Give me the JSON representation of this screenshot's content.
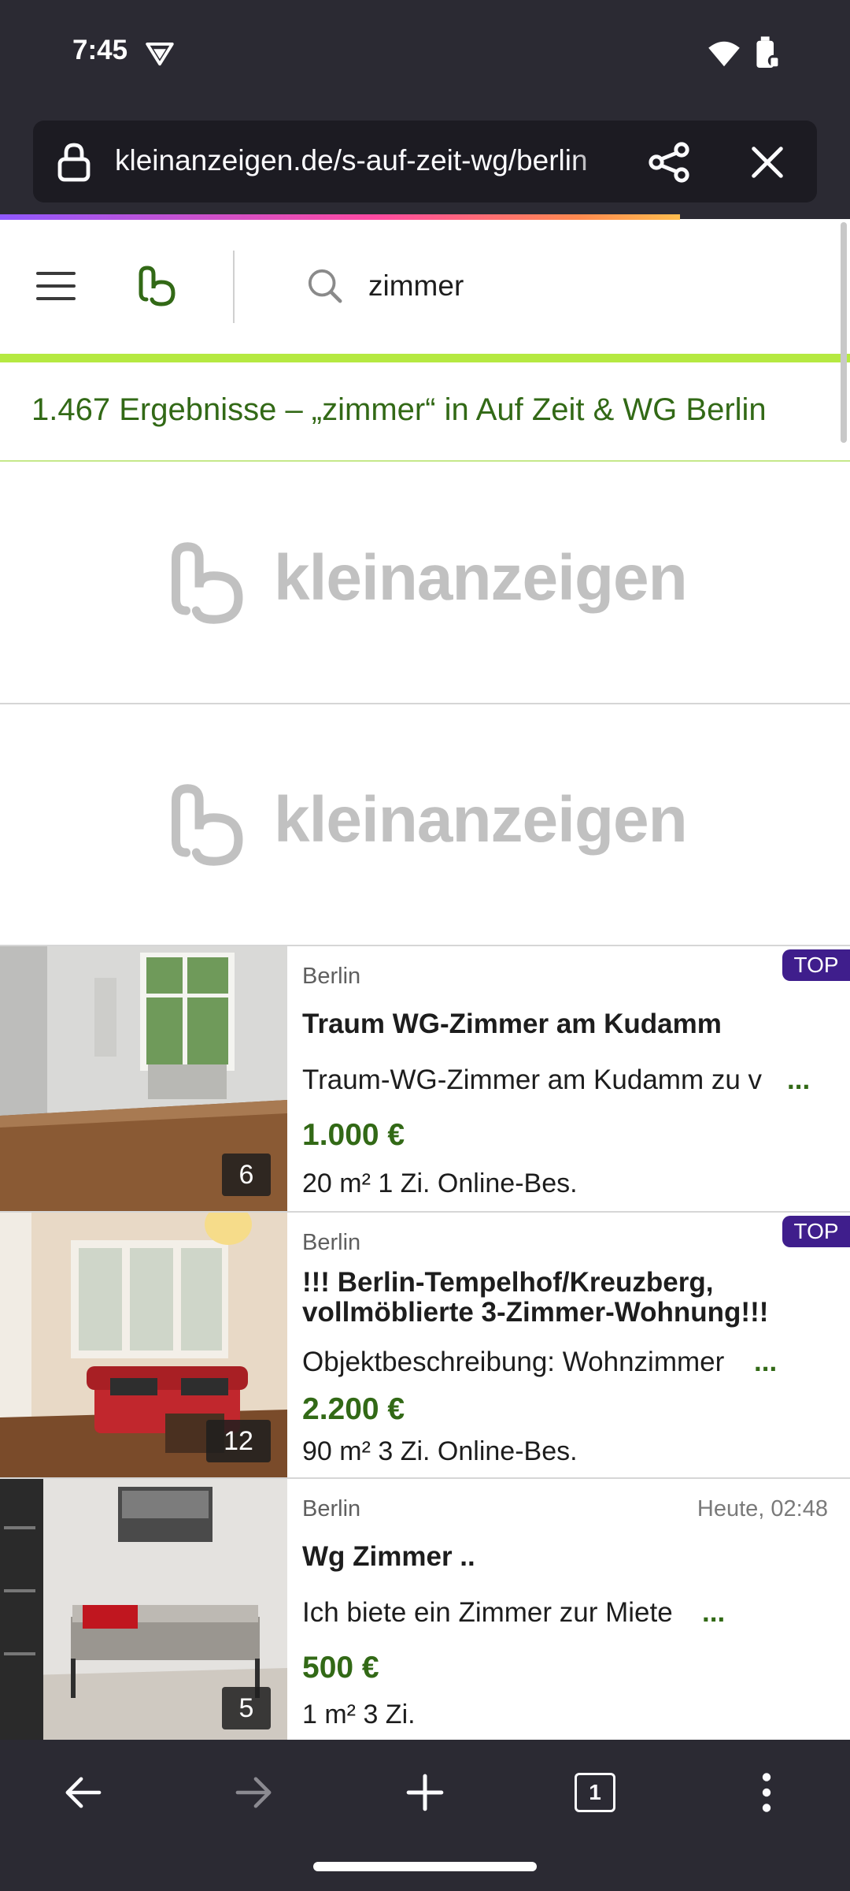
{
  "status_bar": {
    "time": "7:45"
  },
  "browser": {
    "url": "kleinanzeigen.de/s-auf-zeit-wg/berlin",
    "icons": [
      "lock-icon",
      "share-icon",
      "close-icon"
    ]
  },
  "site_header": {
    "search_query": "zimmer"
  },
  "results_text": "1.467 Ergebnisse – „zimmer“ in Auf Zeit & WG Berlin",
  "ad_placeholders": [
    {
      "logo_text": "kleinanzeigen"
    },
    {
      "logo_text": "kleinanzeigen"
    }
  ],
  "listings": [
    {
      "location": "Berlin",
      "badge": "TOP",
      "date": "",
      "title": "Traum WG-Zimmer am Kudamm",
      "description": "Traum-WG-Zimmer am Kudamm zu v",
      "more": "...",
      "price": "1.000 €",
      "specs": "20 m² 1 Zi. Online-Bes.",
      "image_count": "6"
    },
    {
      "location": "Berlin",
      "badge": "TOP",
      "date": "",
      "title": "!!! Berlin-Tempelhof/Kreuzberg, vollmöblierte 3-Zimmer-Wohnung!!!",
      "description": "Objektbeschreibung: Wohnzimmer",
      "more": "...",
      "price": "2.200 €",
      "specs": "90 m² 3 Zi. Online-Bes.",
      "image_count": "12"
    },
    {
      "location": "Berlin",
      "badge": "",
      "date": "Heute, 02:48",
      "title": "Wg Zimmer ..",
      "description": "Ich biete ein Zimmer zur Miete",
      "more": "...",
      "price": "500 €",
      "specs": "1 m² 3 Zi.",
      "image_count": "5"
    }
  ],
  "bottom_bar": {
    "tab_count": "1"
  },
  "colors": {
    "brand_green": "#326916",
    "accent_lime": "#b5e941",
    "top_badge": "#3f1e8c",
    "chrome": "#2b2a33"
  }
}
